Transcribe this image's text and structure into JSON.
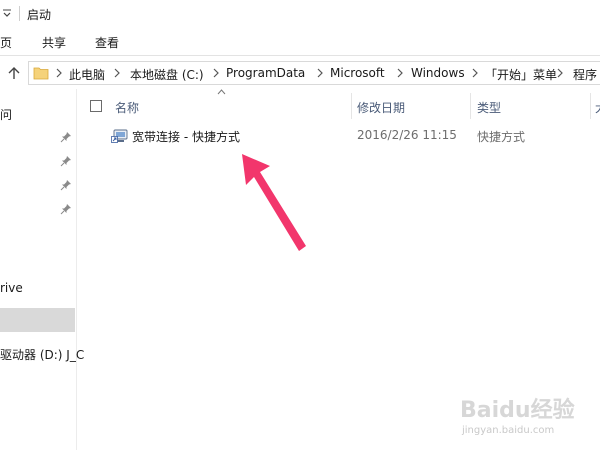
{
  "window": {
    "title": "启动"
  },
  "ribbon": {
    "tabs": [
      {
        "label": "页"
      },
      {
        "label": "共享"
      },
      {
        "label": "查看"
      }
    ]
  },
  "address": {
    "segments": [
      {
        "label": "此电脑"
      },
      {
        "label": "本地磁盘 (C:)"
      },
      {
        "label": "ProgramData"
      },
      {
        "label": "Microsoft"
      },
      {
        "label": "Windows"
      },
      {
        "label": "「开始」菜单"
      },
      {
        "label": "程序"
      }
    ]
  },
  "nav": {
    "items": [
      {
        "label": "问"
      },
      {
        "label": "rive"
      },
      {
        "label": "驱动器 (D:) J_C"
      }
    ]
  },
  "columns": {
    "name": "名称",
    "date": "修改日期",
    "type": "类型",
    "extra": "大"
  },
  "files": [
    {
      "name": "宽带连接 - 快捷方式",
      "date": "2016/2/26 11:15",
      "type": "快捷方式"
    }
  ],
  "watermark": {
    "logo_text": "Baidu经验",
    "url": "jingyan.baidu.com"
  },
  "colors": {
    "annotation_arrow": "#f2366c",
    "header_text": "#4a5b78",
    "selection": "#d9d9d9",
    "folder": "#f5d27a"
  },
  "icons": {
    "up": "up-arrow-icon",
    "folder": "folder-icon",
    "pin": "pin-icon",
    "shortcut": "broadband-shortcut-icon"
  }
}
